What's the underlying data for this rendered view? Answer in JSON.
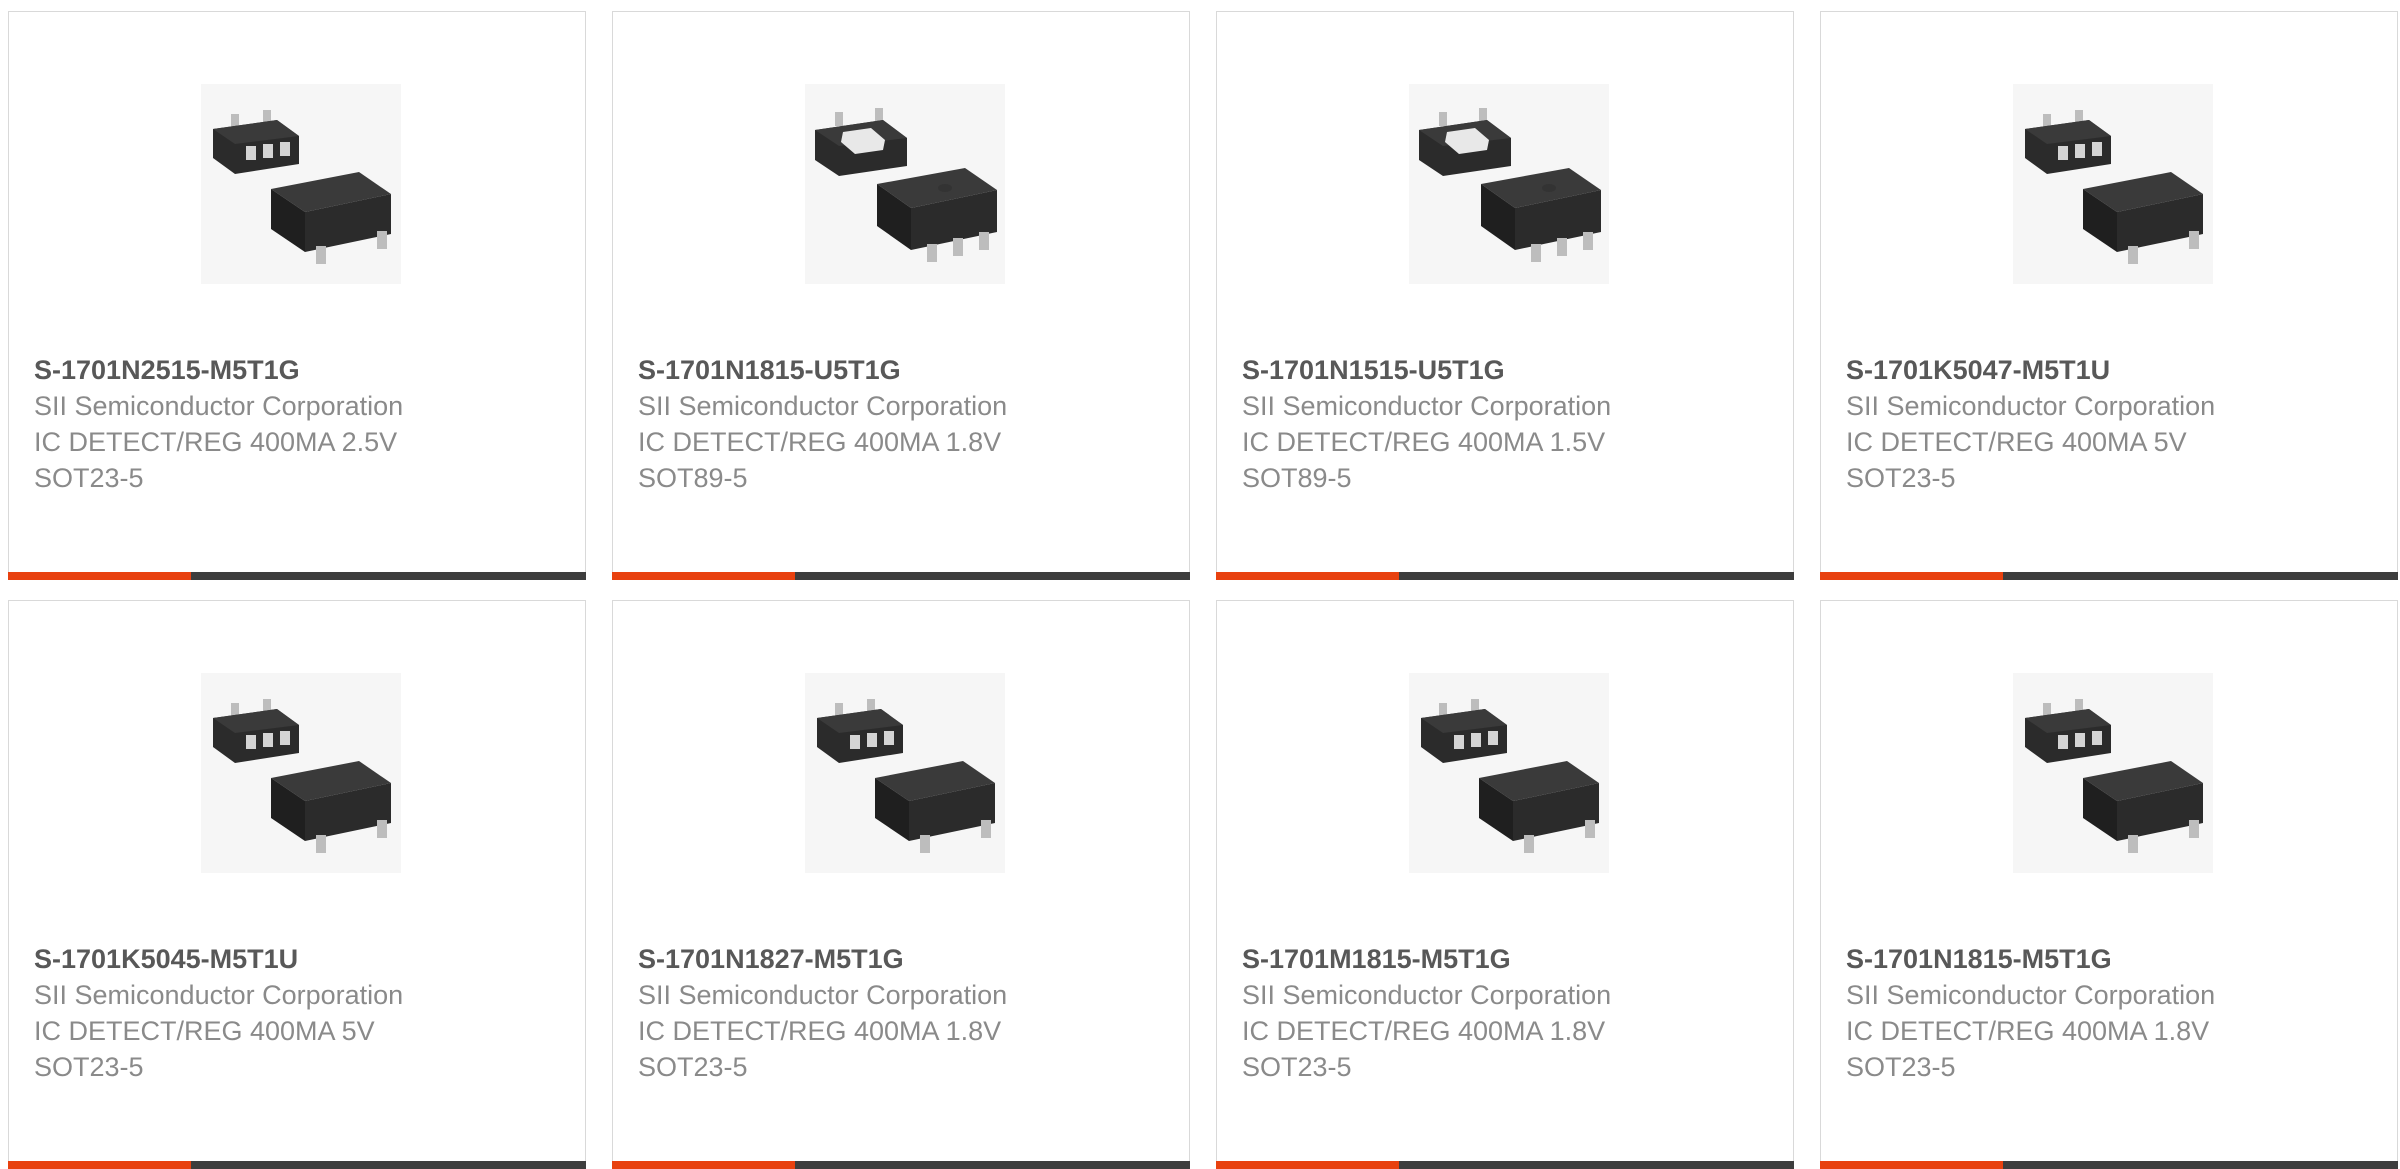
{
  "accent_color": "#e8410f",
  "products": [
    {
      "part_number": "S-1701N2515-M5T1G",
      "manufacturer": "SII Semiconductor Corporation",
      "description": "IC DETECT/REG 400MA 2.5V",
      "package": "SOT23-5",
      "image_icon": "sot23-5-package-icon"
    },
    {
      "part_number": "S-1701N1815-U5T1G",
      "manufacturer": "SII Semiconductor Corporation",
      "description": "IC DETECT/REG 400MA 1.8V",
      "package": "SOT89-5",
      "image_icon": "sot89-5-package-icon"
    },
    {
      "part_number": "S-1701N1515-U5T1G",
      "manufacturer": "SII Semiconductor Corporation",
      "description": "IC DETECT/REG 400MA 1.5V",
      "package": "SOT89-5",
      "image_icon": "sot89-5-package-icon"
    },
    {
      "part_number": "S-1701K5047-M5T1U",
      "manufacturer": "SII Semiconductor Corporation",
      "description": "IC DETECT/REG 400MA 5V",
      "package": "SOT23-5",
      "image_icon": "sot23-5-package-icon"
    },
    {
      "part_number": "S-1701K5045-M5T1U",
      "manufacturer": "SII Semiconductor Corporation",
      "description": "IC DETECT/REG 400MA 5V",
      "package": "SOT23-5",
      "image_icon": "sot23-5-package-icon"
    },
    {
      "part_number": "S-1701N1827-M5T1G",
      "manufacturer": "SII Semiconductor Corporation",
      "description": "IC DETECT/REG 400MA 1.8V",
      "package": "SOT23-5",
      "image_icon": "sot23-5-package-icon"
    },
    {
      "part_number": "S-1701M1815-M5T1G",
      "manufacturer": "SII Semiconductor Corporation",
      "description": "IC DETECT/REG 400MA 1.8V",
      "package": "SOT23-5",
      "image_icon": "sot23-5-package-icon"
    },
    {
      "part_number": "S-1701N1815-M5T1G",
      "manufacturer": "SII Semiconductor Corporation",
      "description": "IC DETECT/REG 400MA 1.8V",
      "package": "SOT23-5",
      "image_icon": "sot23-5-package-icon"
    }
  ]
}
